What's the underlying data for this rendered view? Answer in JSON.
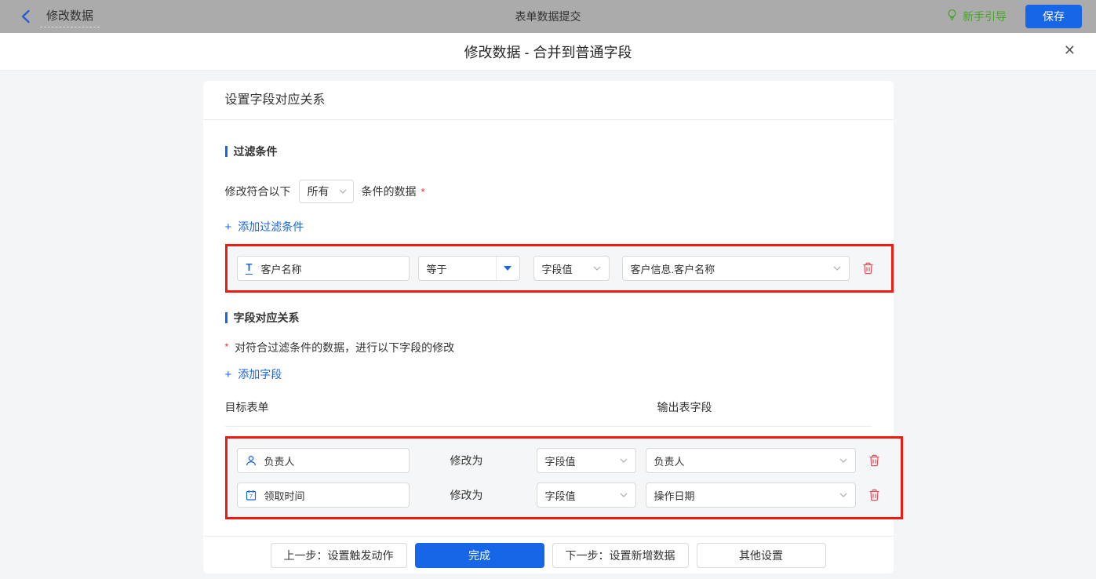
{
  "topbar": {
    "back_label": "修改数据",
    "center_title": "表单数据提交",
    "guide_label": "新手引导",
    "save_label": "保存"
  },
  "modal": {
    "title": "修改数据 - 合并到普通字段",
    "close_glyph": "✕"
  },
  "panel": {
    "header": "设置字段对应关系"
  },
  "filter": {
    "section_title": "过滤条件",
    "match_prefix": "修改符合以下",
    "match_value": "所有",
    "match_suffix": "条件的数据",
    "required_mark": "*",
    "add_icon": "+",
    "add_label": "添加过滤条件",
    "conditions": [
      {
        "field_icon_glyph": "T",
        "field": "客户名称",
        "operator": "等于",
        "value_type": "字段值",
        "value": "客户信息.客户名称"
      }
    ]
  },
  "mapping": {
    "section_title": "字段对应关系",
    "required_mark": "*",
    "description": "对符合过滤条件的数据，进行以下字段的修改",
    "add_icon": "+",
    "add_label": "添加字段",
    "columns": {
      "target": "目标表单",
      "output": "输出表字段"
    },
    "rows": [
      {
        "field": "负责人",
        "action": "修改为",
        "value_type": "字段值",
        "value": "负责人"
      },
      {
        "field": "领取时间",
        "action": "修改为",
        "value_type": "字段值",
        "value": "操作日期"
      }
    ]
  },
  "footer": {
    "prev_label": "上一步：设置触发动作",
    "done_label": "完成",
    "next_label": "下一步：设置新增数据",
    "other_label": "其他设置"
  },
  "colors": {
    "accent_blue": "#1766e8",
    "annotation_red": "#f2190d",
    "guide_green": "#44a824",
    "danger_red": "#e0515e",
    "topbar_gray": "#ababab"
  }
}
